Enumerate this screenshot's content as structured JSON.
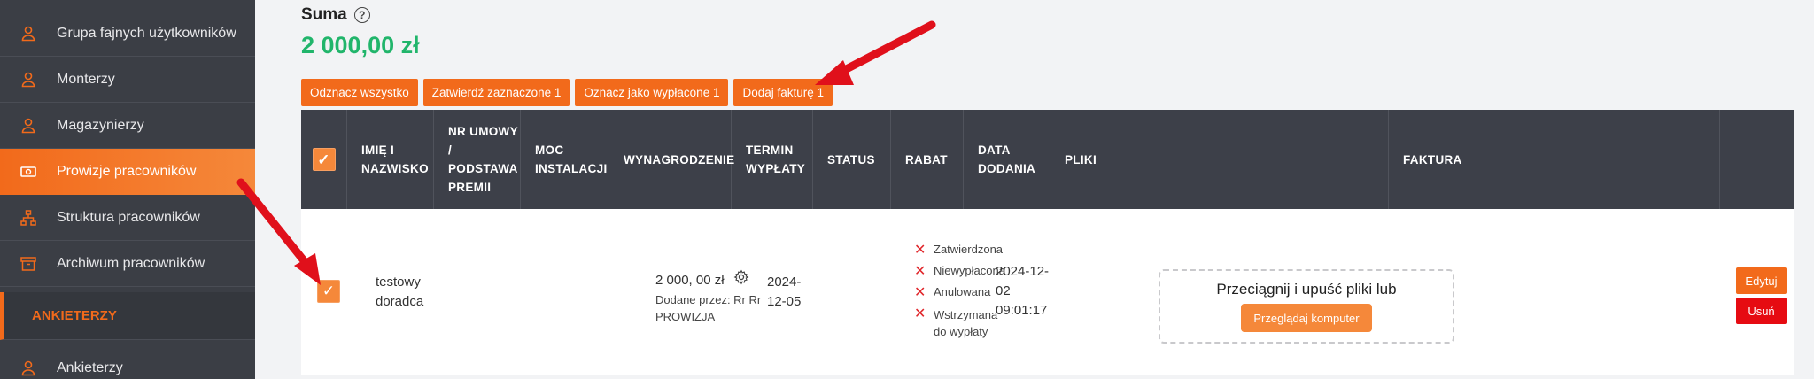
{
  "sidebar": {
    "items": [
      {
        "label": "Grupa fajnych użytkowników",
        "icon": "user-icon"
      },
      {
        "label": "Monterzy",
        "icon": "user-icon"
      },
      {
        "label": "Magazynierzy",
        "icon": "user-icon"
      },
      {
        "label": "Prowizje pracowników",
        "icon": "money-icon"
      },
      {
        "label": "Struktura pracowników",
        "icon": "hierarchy-icon"
      },
      {
        "label": "Archiwum pracowników",
        "icon": "archive-icon"
      }
    ],
    "section": "ANKIETERZY",
    "section_items": [
      {
        "label": "Ankieterzy",
        "icon": "user-icon"
      }
    ]
  },
  "summary": {
    "label": "Suma",
    "value": "2 000,00 zł"
  },
  "actions": {
    "deselect_all": "Odznacz wszystko",
    "approve_selected": "Zatwierdź zaznaczone 1",
    "mark_paid": "Oznacz jako wypłacone 1",
    "add_invoice": "Dodaj fakturę 1"
  },
  "table": {
    "headers": {
      "name": "IMIĘ I NAZWISKO",
      "contract": "NR UMOWY / PODSTAWA PREMII",
      "power": "MOC INSTALACJI",
      "salary": "WYNAGRODZENIE",
      "payment_term": "TERMIN WYPŁATY",
      "status": "STATUS",
      "discount": "RABAT",
      "date_added": "DATA DODANIA",
      "files": "PLIKI",
      "invoice": "FAKTURA"
    },
    "row": {
      "checked": true,
      "name": "testowy doradca",
      "salary_amount": "2 000, 00 zł",
      "added_by": "Dodane przez: Rr Rr",
      "type": "PROWIZJA",
      "payment_term": "2024-12-05",
      "statuses": [
        "Zatwierdzona",
        "Niewypłacona",
        "Anulowana",
        "Wstrzymana do wypłaty"
      ],
      "date_added": "2024-12-02 09:01:17",
      "dropzone_text": "Przeciągnij i upuść pliki lub",
      "browse_label": "Przeglądaj komputer",
      "edit_label": "Edytuj",
      "delete_label": "Usuń"
    }
  },
  "colors": {
    "accent": "#f26a1b",
    "sidebar": "#3b3e45",
    "table_header": "#3d4049",
    "success": "#21b56b",
    "danger": "#e60b12",
    "annotation_arrow": "#e0101b"
  }
}
